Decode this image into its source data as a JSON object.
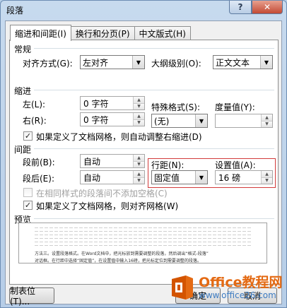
{
  "window": {
    "title": "段落",
    "help": "?",
    "close": "✕"
  },
  "tabs": [
    "缩进和间距(I)",
    "换行和分页(P)",
    "中文版式(H)"
  ],
  "general": {
    "heading": "常规",
    "alignment_label": "对齐方式(G):",
    "alignment_value": "左对齐",
    "outline_label": "大纲级别(O):",
    "outline_value": "正文文本"
  },
  "indent": {
    "heading": "缩进",
    "left_label": "左(L):",
    "left_value": "0 字符",
    "right_label": "右(R):",
    "right_value": "0 字符",
    "special_label": "特殊格式(S):",
    "special_value": "(无)",
    "by_label": "度量值(Y):",
    "by_value": "",
    "grid_check": "如果定义了文档网格，则自动调整右缩进(D)",
    "grid_checked": true
  },
  "spacing": {
    "heading": "间距",
    "before_label": "段前(B):",
    "before_value": "自动",
    "after_label": "段后(E):",
    "after_value": "自动",
    "line_label": "行距(N):",
    "line_value": "固定值",
    "at_label": "设置值(A):",
    "at_value": "16 磅",
    "nospace_check": "在相同样式的段落间不添加空格(C)",
    "nospace_checked": false,
    "snap_check": "如果定义了文档网格，则对齐网格(W)",
    "snap_checked": true
  },
  "preview": {
    "heading": "预览",
    "sample_line1": "方法三。设置段落格式。在Word文档中，把光标放到需要调整的段落，然后调出“格式-段落”",
    "sample_line2": "对话框。在行距中选择“固定值”，在设置值中输入16磅，把光标定位到需要调整的段落。"
  },
  "buttons": {
    "tabs_button": "制表位(T)...",
    "ok": "确定",
    "cancel": "取消"
  },
  "watermark": {
    "main": "Office教程网",
    "sub": "www.office26.com"
  },
  "colors": {
    "highlight": "#d23b3b",
    "watermark_orange": "#e46a13",
    "watermark_blue": "#3d7bc1"
  }
}
